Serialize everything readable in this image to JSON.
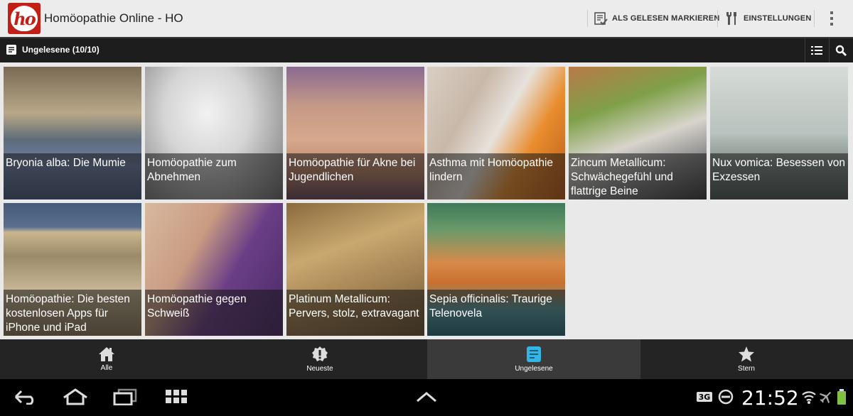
{
  "app": {
    "logo_text": "ho",
    "title": "Homöopathie Online - HO"
  },
  "actions": {
    "mark_read": "ALS GELESEN MARKIEREN",
    "settings": "EINSTELLUNGEN"
  },
  "subbar": {
    "title": "Ungelesene (10/10)"
  },
  "articles": [
    {
      "caption": "Bryonia alba: Die Mumie"
    },
    {
      "caption": "Homöopathie zum Abnehmen"
    },
    {
      "caption": "Homöopathie für Akne bei Jugendlichen"
    },
    {
      "caption": "Asthma mit Homöopathie lindern"
    },
    {
      "caption": "Zincum Metallicum: Schwächegefühl und flattrige Beine"
    },
    {
      "caption": "Nux vomica: Besessen von Exzessen"
    },
    {
      "caption": "Homöopathie: Die besten kostenlosen Apps für iPhone und iPad"
    },
    {
      "caption": "Homöopathie gegen Schweiß"
    },
    {
      "caption": "Platinum Metallicum: Pervers, stolz, extravagant"
    },
    {
      "caption": "Sepia officinalis: Traurige Telenovela"
    }
  ],
  "tabs": [
    {
      "label": "Alle",
      "icon": "home-icon"
    },
    {
      "label": "Neueste",
      "icon": "alert-badge-icon"
    },
    {
      "label": "Ungelesene",
      "icon": "document-icon",
      "active": true
    },
    {
      "label": "Stern",
      "icon": "star-icon"
    }
  ],
  "system": {
    "time": "21:52",
    "accent_color": "#33b5e5"
  },
  "colors": {
    "brand": "#c21f17",
    "tab_active": "#3a3a3a"
  }
}
